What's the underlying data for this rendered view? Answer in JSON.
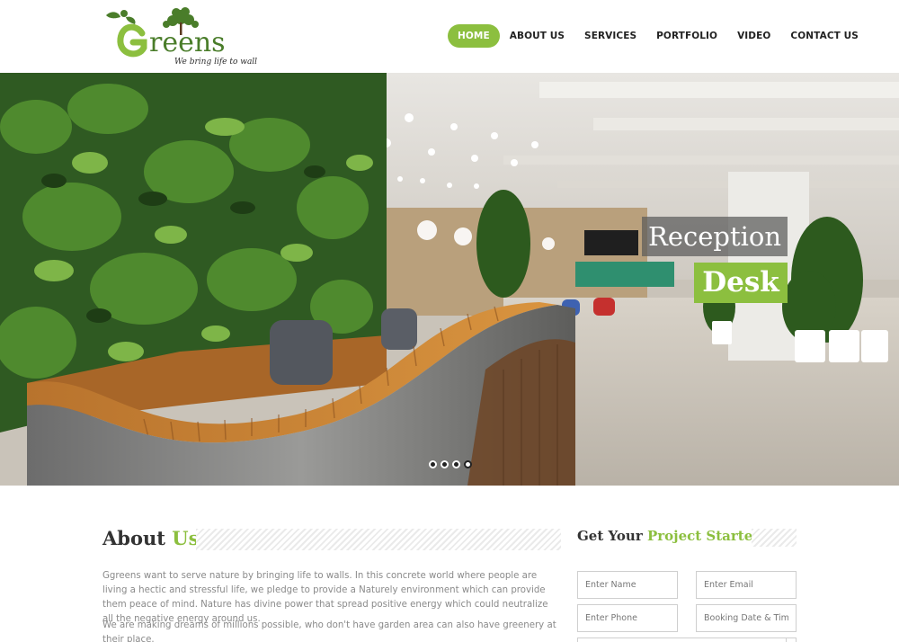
{
  "brand": {
    "logo_text": "Ggreens",
    "tagline": "We bring life to walls",
    "accent_color": "#8cbf3f",
    "logo_color": "#4a7d2a"
  },
  "nav": {
    "items": [
      {
        "label": "HOME",
        "active": true
      },
      {
        "label": "ABOUT US",
        "active": false
      },
      {
        "label": "SERVICES",
        "active": false
      },
      {
        "label": "PORTFOLIO",
        "active": false
      },
      {
        "label": "VIDEO",
        "active": false
      },
      {
        "label": "CONTACT US",
        "active": false
      }
    ]
  },
  "hero": {
    "caption_line1": "Reception",
    "caption_line2": "Desk",
    "slide_count": 4,
    "active_slide": 4
  },
  "about": {
    "title_plain": "About",
    "title_accent": "Us",
    "paragraph1": "Ggreens want to serve nature by bringing life to walls. In this concrete world where people are living a hectic and stressful life, we pledge to provide a Naturely environment which can provide them peace of mind. Nature has divine power that spread positive energy which could neutralize all the negative energy around us.",
    "paragraph2": "We are making dreams of millions possible, who don't have garden area can also have greenery at their place."
  },
  "form": {
    "title_plain": "Get Your",
    "title_accent": "Project Started",
    "name_placeholder": "Enter Name",
    "email_placeholder": "Enter Email",
    "phone_placeholder": "Enter Phone",
    "date_placeholder": "Booking Date & Time"
  }
}
